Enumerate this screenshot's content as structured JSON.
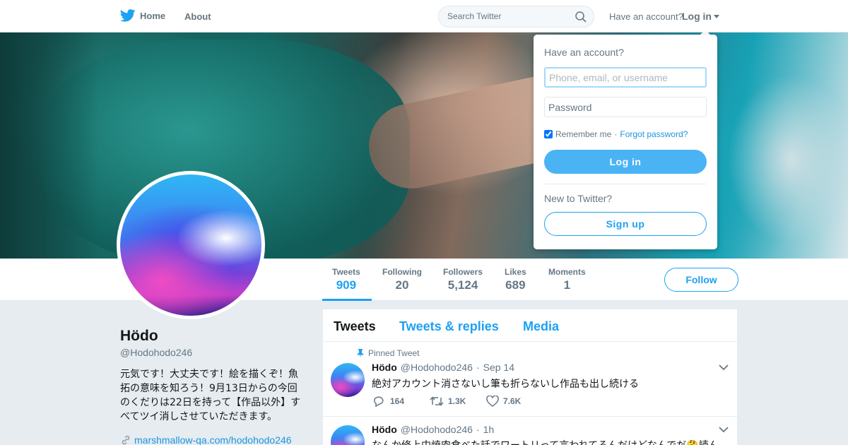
{
  "nav": {
    "home_label": "Home",
    "about_label": "About",
    "search_placeholder": "Search Twitter",
    "have_account": "Have an account?",
    "login_label": "Log in"
  },
  "stats": [
    {
      "label": "Tweets",
      "value": "909"
    },
    {
      "label": "Following",
      "value": "20"
    },
    {
      "label": "Followers",
      "value": "5,124"
    },
    {
      "label": "Likes",
      "value": "689"
    },
    {
      "label": "Moments",
      "value": "1"
    }
  ],
  "follow_label": "Follow",
  "profile": {
    "name": "Hödo",
    "handle": "@Hodohodo246",
    "bio": "元気です！大丈夫です！絵を描くぞ！魚拓の意味を知ろう！9月13日からの今回のくだりは22日を持って【作品以外】すべてツイ消しさせていただきます。",
    "link": "marshmallow-qa.com/hodohodo246"
  },
  "tabs": [
    "Tweets",
    "Tweets & replies",
    "Media"
  ],
  "tweets": [
    {
      "pinned_label": "Pinned Tweet",
      "name": "Hödo",
      "handle": "@Hodohodo246",
      "sep": "·",
      "date": "Sep 14",
      "text": "絶対アカウント消さないし筆も折らないし作品も出し続ける",
      "replies": "164",
      "retweets": "1.3K",
      "likes": "7.6K"
    },
    {
      "name": "Hödo",
      "handle": "@Hodohodo246",
      "sep": "·",
      "date": "1h",
      "text": "なんか修上中焼肉食べた話でワートリって言われてるんだけどなんでだ🤔読ん"
    }
  ],
  "login_dropdown": {
    "title": "Have an account?",
    "username_placeholder": "Phone, email, or username",
    "password_placeholder": "Password",
    "remember_label": "Remember me",
    "sep": "·",
    "forgot_label": "Forgot password?",
    "login_button": "Log in",
    "new_label": "New to Twitter?",
    "signup_button": "Sign up",
    "remember_checked": true
  },
  "colors": {
    "accent": "#1da1f2",
    "login_button": "#4ab3f4",
    "background": "#e6ecf0"
  },
  "icons": [
    "twitter-bird-icon",
    "search-icon",
    "caret-down-icon",
    "pin-icon",
    "chevron-down-icon",
    "reply-icon",
    "retweet-icon",
    "heart-icon",
    "link-icon"
  ]
}
